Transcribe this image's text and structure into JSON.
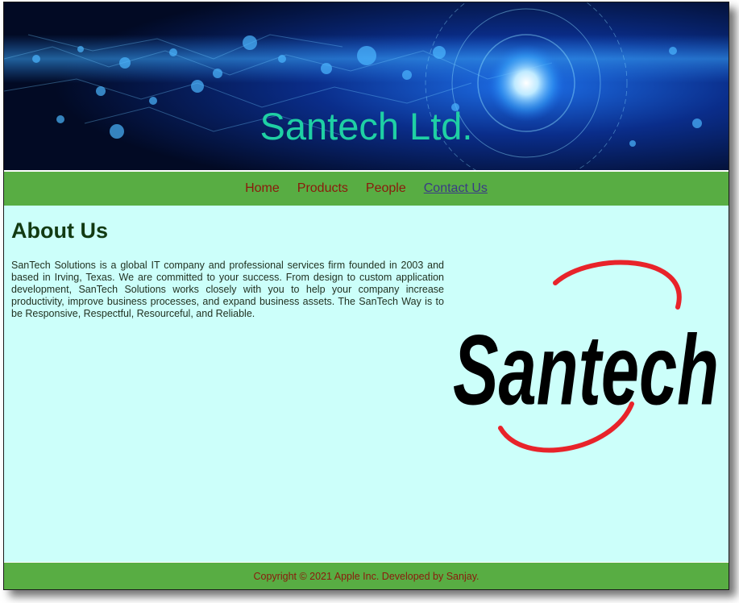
{
  "banner": {
    "title": "Santech Ltd."
  },
  "nav": {
    "items": [
      {
        "label": "Home"
      },
      {
        "label": "Products"
      },
      {
        "label": "People"
      },
      {
        "label": "Contact Us"
      }
    ],
    "active_label": "Contact Us"
  },
  "main": {
    "heading": "About Us",
    "paragraph": "SanTech Solutions is a global IT company and professional services firm founded in 2003 and based in Irving, Texas. We are committed to your success. From design to custom application development, SanTech Solutions works closely with you to help your company increase productivity, improve business processes, and expand business assets. The SanTech Way is to be Responsive, Respectful, Resourceful, and Reliable.",
    "logo": {
      "wordmark": "Santech",
      "ring_color": "#e8232a",
      "text_color": "#000000"
    }
  },
  "footer": {
    "text": "Copyright © 2021 Apple Inc. Developed by Sanjay."
  },
  "colors": {
    "page_bg": "#ccfffa",
    "nav_bg": "#58ad43",
    "link": "#8b1a0c",
    "title": "#1fd0a4",
    "heading": "#123a12"
  }
}
